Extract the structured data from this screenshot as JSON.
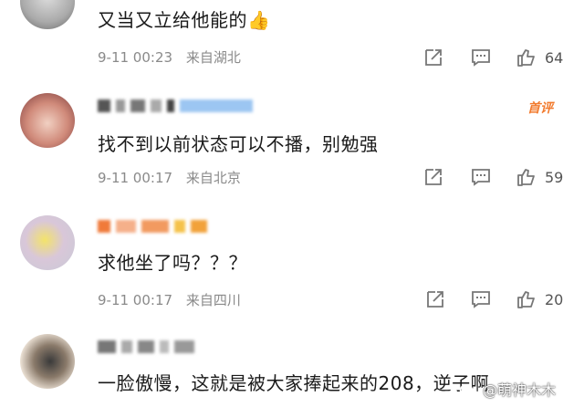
{
  "comments": [
    {
      "text": "又当又立给他能的👍",
      "time": "9-11 00:23",
      "location": "来自湖北",
      "likes": "64"
    },
    {
      "text": "找不到以前状态可以不播，别勉强",
      "time": "9-11 00:17",
      "location": "来自北京",
      "likes": "59",
      "badge": "首评"
    },
    {
      "text": "求他坐了吗？？？",
      "time": "9-11 00:17",
      "location": "来自四川",
      "likes": "20"
    },
    {
      "text": "一脸傲慢，这就是被大家捧起来的208，逆子啊"
    }
  ],
  "watermark": "@萌神木木",
  "colors": {
    "badge": "#f27b2e",
    "meta": "#8a8a8a",
    "icon": "#777777"
  },
  "icons": [
    "share-icon",
    "comment-icon",
    "like-icon"
  ]
}
